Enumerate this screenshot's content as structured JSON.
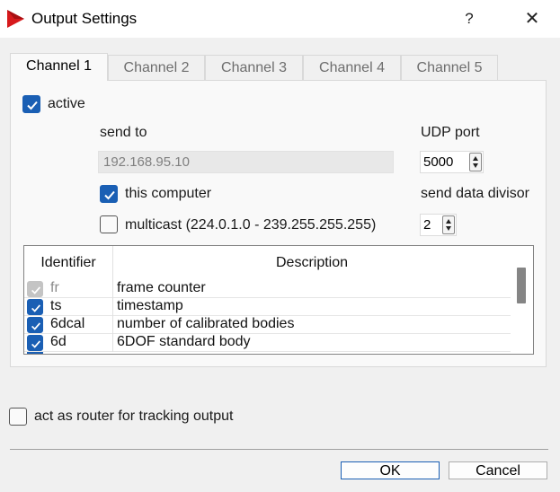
{
  "window": {
    "title": "Output Settings",
    "help": "?",
    "close": "✕"
  },
  "tabs": [
    {
      "label": "Channel 1",
      "active": true
    },
    {
      "label": "Channel 2",
      "active": false
    },
    {
      "label": "Channel 3",
      "active": false
    },
    {
      "label": "Channel 4",
      "active": false
    },
    {
      "label": "Channel 5",
      "active": false
    }
  ],
  "channel": {
    "active_label": "active",
    "active_checked": true,
    "send_to_label": "send to",
    "ip_value": "192.168.95.10",
    "udp_port_label": "UDP port",
    "udp_port_value": "5000",
    "this_computer_label": "this computer",
    "this_computer_checked": true,
    "multicast_label": "multicast (224.0.1.0 - 239.255.255.255)",
    "multicast_checked": false,
    "divisor_label": "send data divisor",
    "divisor_value": "2"
  },
  "table": {
    "columns": [
      "Identifier",
      "Description"
    ],
    "rows": [
      {
        "id": "fr",
        "description": "frame counter",
        "checked": true,
        "disabled": true
      },
      {
        "id": "ts",
        "description": "timestamp",
        "checked": true,
        "disabled": false
      },
      {
        "id": "6dcal",
        "description": "number of calibrated bodies",
        "checked": true,
        "disabled": false
      },
      {
        "id": "6d",
        "description": "6DOF standard body",
        "checked": true,
        "disabled": false
      }
    ]
  },
  "router": {
    "label": "act as router for tracking output",
    "checked": false
  },
  "buttons": {
    "ok": "OK",
    "cancel": "Cancel"
  },
  "colors": {
    "accent": "#1a5fb4",
    "app_icon": "#d7191c"
  }
}
